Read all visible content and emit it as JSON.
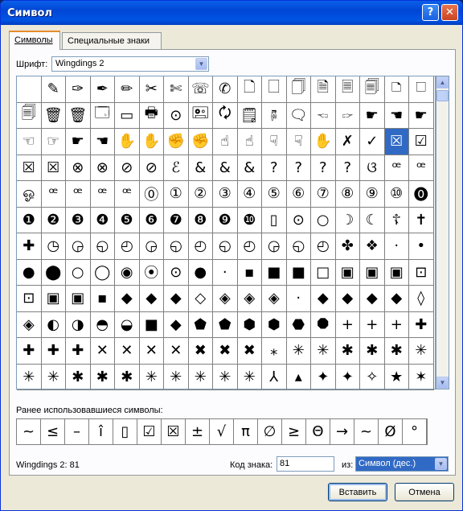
{
  "window": {
    "title": "Символ",
    "help": "?",
    "close": "✕"
  },
  "tabs": [
    {
      "label": "Символы"
    },
    {
      "label": "Специальные знаки"
    }
  ],
  "font": {
    "label": "Шрифт:",
    "value": "Wingdings 2"
  },
  "grid": {
    "selected_row": 2,
    "selected_col": 15,
    "rows": [
      [
        " ",
        "✎",
        "✑",
        "✒",
        "✏",
        "✂",
        "✄",
        "☏",
        "✆",
        "🗋",
        "🗌",
        "🗍",
        "🗎",
        "🗏",
        "🗐",
        "🗅",
        "🗆"
      ],
      [
        "🗐",
        "🗑",
        "🗑",
        "🗔",
        "▭",
        "🖶",
        "⊙",
        "🖭",
        "🗘",
        "🗒",
        "🖗",
        "🗨",
        "🖘",
        "🖙",
        "☛",
        "☚",
        "☛"
      ],
      [
        "☜",
        "☞",
        "☛",
        "☚",
        "✋",
        "✋",
        "✊",
        "✊",
        "☝",
        "☝",
        "☟",
        "☟",
        "✋",
        "✗",
        "✓",
        "☒",
        "☑"
      ],
      [
        "☒",
        "☒",
        "⊗",
        "⊗",
        "⊘",
        "⊘",
        "ℰ",
        "&",
        "&",
        "&",
        "?",
        "?",
        "?",
        "?",
        "ଓ",
        "ꟹ",
        "ꟹ"
      ],
      [
        "ஓ",
        "ꟹ",
        "ꟹ",
        "ꟹ",
        "ꟹ",
        "⓪",
        "①",
        "②",
        "③",
        "④",
        "⑤",
        "⑥",
        "⑦",
        "⑧",
        "⑨",
        "⑩",
        "⓿"
      ],
      [
        "❶",
        "❷",
        "❸",
        "❹",
        "❺",
        "❻",
        "❼",
        "❽",
        "❾",
        "❿",
        "▯",
        "⊙",
        "○",
        "☽",
        "☾",
        "☦",
        "✝"
      ],
      [
        "✚",
        "◷",
        "◶",
        "◵",
        "◴",
        "◶",
        "◵",
        "◴",
        "◵",
        "◴",
        "◶",
        "◵",
        "◴",
        "✤",
        "❖",
        "·",
        "•"
      ],
      [
        "●",
        "⬤",
        "○",
        "◯",
        "◉",
        "⦿",
        "⊙",
        "●",
        "·",
        "▪",
        "■",
        "■",
        "□",
        "▣",
        "▣",
        "▣",
        "⊡"
      ],
      [
        "⊡",
        "▣",
        "▣",
        "▪",
        "◆",
        "◆",
        "◆",
        "◇",
        "◈",
        "◈",
        "◈",
        "·",
        "◆",
        "◆",
        "◆",
        "◆",
        "◊"
      ],
      [
        "◈",
        "◐",
        "◑",
        "◓",
        "◒",
        "■",
        "◆",
        "⬟",
        "⬟",
        "⬢",
        "⬢",
        "⬣",
        "⯃",
        "+",
        "+",
        "+",
        "✚"
      ],
      [
        "✚",
        "✚",
        "✚",
        "✕",
        "✕",
        "✕",
        "✕",
        "✖",
        "✖",
        "✖",
        "⁎",
        "✳",
        "✳",
        "✱",
        "✱",
        "✱",
        "✳"
      ],
      [
        "✳",
        "✳",
        "✱",
        "✱",
        "✱",
        "✳",
        "✳",
        "✳",
        "✳",
        "✳",
        "⅄",
        "▴",
        "✦",
        "✦",
        "✧",
        "★",
        "✶"
      ]
    ]
  },
  "recent": {
    "label": "Ранее использовавшиеся символы:",
    "items": [
      "~",
      "≤",
      "–",
      "î",
      "▯",
      "☑",
      "☒",
      "±",
      "√",
      "π",
      "∅",
      "≥",
      "Θ",
      "→",
      "~",
      "Ø",
      "°"
    ]
  },
  "status": "Wingdings 2: 81",
  "code": {
    "label": "Код знака:",
    "value": "81"
  },
  "from": {
    "label": "из:",
    "value": "Символ (дес.)"
  },
  "buttons": {
    "insert": "Вставить",
    "cancel": "Отмена"
  },
  "colors": {
    "title_bar": "#0054e3",
    "selection": "#316ac5",
    "window": "#ece9d8"
  }
}
